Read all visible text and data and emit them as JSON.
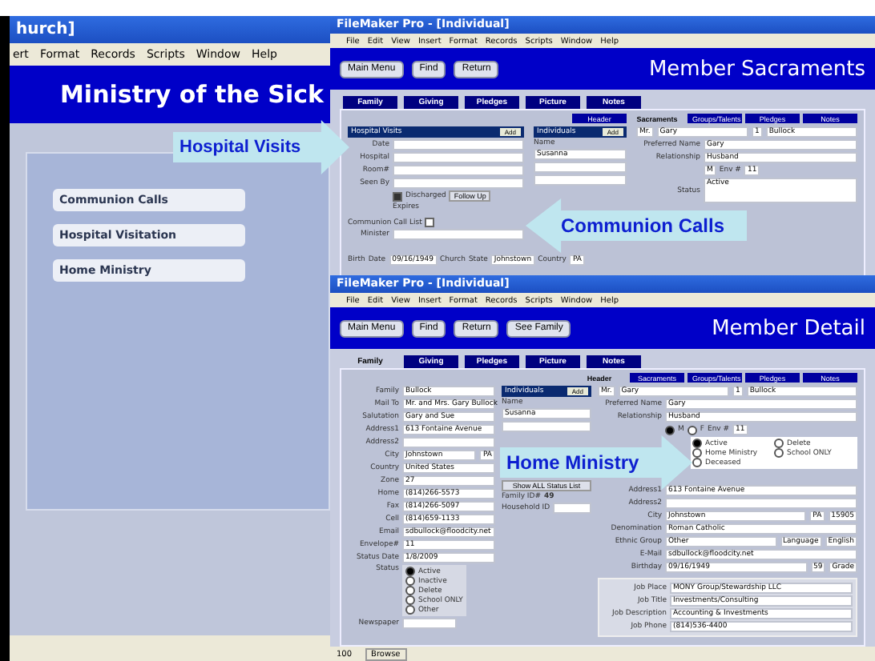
{
  "back_window": {
    "title": "hurch]",
    "menu": [
      "ert",
      "Format",
      "Records",
      "Scripts",
      "Window",
      "Help"
    ],
    "header": "Ministry of the Sick",
    "menu_buttons": [
      "Communion Calls",
      "Hospital Visitation",
      "Home Ministry"
    ]
  },
  "sacraments_window": {
    "title": "FileMaker Pro - [Individual]",
    "menu": [
      "File",
      "Edit",
      "View",
      "Insert",
      "Format",
      "Records",
      "Scripts",
      "Window",
      "Help"
    ],
    "toolbar": [
      "Main Menu",
      "Find",
      "Return"
    ],
    "header": "Member Sacraments",
    "tabs": [
      {
        "label": "Family",
        "selected": false
      },
      {
        "label": "Giving",
        "selected": false
      },
      {
        "label": "Pledges",
        "selected": false
      },
      {
        "label": "Picture",
        "selected": false
      },
      {
        "label": "Notes",
        "selected": false
      }
    ],
    "subtabs": [
      {
        "label": "Header",
        "selected": false
      },
      {
        "label": "Sacraments",
        "selected": true
      },
      {
        "label": "Groups/Talents",
        "selected": false
      },
      {
        "label": "Pledges",
        "selected": false
      },
      {
        "label": "Notes",
        "selected": false
      }
    ],
    "hospital_visits": {
      "title": "Hospital Visits",
      "add": "Add",
      "fields": [
        "Date",
        "Hospital",
        "Room#",
        "Seen By"
      ],
      "discharged": {
        "label": "Discharged",
        "checked": true
      },
      "follow_up": "Follow Up",
      "expires": "Expires"
    },
    "communion": {
      "label": "Communion Call List",
      "checked": false,
      "minister_label": "Minister"
    },
    "birth": {
      "label": "Birth",
      "date_label": "Date",
      "church_label": "Church",
      "date": "09/16/1949",
      "city": "Johnstown",
      "state": "PA"
    },
    "individuals": {
      "title": "Individuals",
      "add": "Add",
      "column": "Name",
      "rows": [
        "Susanna"
      ]
    },
    "member": {
      "title": "Mr.",
      "first": "Gary",
      "number": "1",
      "last": "Bullock",
      "preferred_label": "Preferred Name",
      "preferred": "Gary",
      "relationship_label": "Relationship",
      "relationship": "Husband",
      "sex": "M",
      "env_label": "Env #",
      "env": "11",
      "status_label": "Status",
      "status": "Active",
      "state_label": "State",
      "country_label": "Country"
    }
  },
  "detail_window": {
    "title": "FileMaker Pro - [Individual]",
    "menu": [
      "File",
      "Edit",
      "View",
      "Insert",
      "Format",
      "Records",
      "Scripts",
      "Window",
      "Help"
    ],
    "toolbar": [
      "Main Menu",
      "Find",
      "Return",
      "See Family"
    ],
    "header": "Member Detail",
    "tabs": [
      {
        "label": "Family",
        "selected": true
      },
      {
        "label": "Giving",
        "selected": false
      },
      {
        "label": "Pledges",
        "selected": false
      },
      {
        "label": "Picture",
        "selected": false
      },
      {
        "label": "Notes",
        "selected": false
      }
    ],
    "subtabs": [
      {
        "label": "Header",
        "selected": true
      },
      {
        "label": "Sacraments",
        "selected": false
      },
      {
        "label": "Groups/Talents",
        "selected": false
      },
      {
        "label": "Pledges",
        "selected": false
      },
      {
        "label": "Notes",
        "selected": false
      }
    ],
    "left_fields": [
      {
        "label": "Family",
        "values": [
          "Bullock"
        ]
      },
      {
        "label": "Mail To",
        "values": [
          "Mr. and Mrs. Gary Bullock"
        ]
      },
      {
        "label": "Salutation",
        "values": [
          "Gary and Sue"
        ]
      },
      {
        "label": "Address1",
        "values": [
          "613 Fontaine Avenue"
        ]
      },
      {
        "label": "Address2"
      },
      {
        "label": "City",
        "values": [
          "Johnstown",
          "PA"
        ]
      },
      {
        "label": "Country",
        "values": [
          "United States"
        ]
      },
      {
        "label": "Zone",
        "values": [
          "27"
        ]
      },
      {
        "label": "Home",
        "values": [
          "(814)266-5573"
        ]
      },
      {
        "label": "Fax",
        "values": [
          "(814)266-5097"
        ]
      },
      {
        "label": "Cell",
        "values": [
          "(814)659-1133"
        ]
      },
      {
        "label": "Email",
        "values": [
          "sdbullock@floodcity.net"
        ]
      },
      {
        "label": "Envelope#",
        "values": [
          "11"
        ]
      },
      {
        "label": "Status Date",
        "values": [
          "1/8/2009"
        ]
      }
    ],
    "left_status": {
      "label": "Status",
      "options": [
        {
          "label": "Active",
          "selected": true
        },
        {
          "label": "Inactive",
          "selected": false
        },
        {
          "label": "Delete",
          "selected": false
        },
        {
          "label": "School ONLY",
          "selected": false
        },
        {
          "label": "Other",
          "selected": false
        }
      ]
    },
    "newspaper_label": "Newspaper",
    "individuals": {
      "title": "Individuals",
      "add": "Add",
      "column": "Name",
      "rows": [
        "Susanna"
      ]
    },
    "show_all": "Show ALL Status List",
    "family_id_label": "Family ID#",
    "family_id": "49",
    "household_label": "Household ID",
    "member": {
      "title": "Mr.",
      "first": "Gary",
      "number": "1",
      "last": "Bullock"
    },
    "right_fields": [
      {
        "label": "Preferred Name",
        "values": [
          "Gary"
        ]
      },
      {
        "label": "Relationship",
        "values": [
          "Husband"
        ]
      }
    ],
    "sex_options": [
      {
        "label": "M",
        "selected": true
      },
      {
        "label": "F",
        "selected": false
      }
    ],
    "env_label": "Env #",
    "env": "11",
    "right_status": [
      {
        "label": "Active",
        "selected": true
      },
      {
        "label": "Delete",
        "selected": false
      },
      {
        "label": "Home Ministry",
        "selected": false
      },
      {
        "label": "School ONLY",
        "selected": false
      },
      {
        "label": "Deceased",
        "selected": false
      }
    ],
    "right_fields_2": [
      {
        "label": "Address1",
        "values": [
          "613 Fontaine Avenue"
        ]
      },
      {
        "label": "Address2"
      },
      {
        "label": "City",
        "values": [
          "Johnstown",
          "PA",
          "15905"
        ]
      },
      {
        "label": "Denomination",
        "values": [
          "Roman Catholic"
        ]
      },
      {
        "label": "Ethnic Group",
        "values": [
          "Other",
          "Language",
          "English"
        ]
      },
      {
        "label": "E-Mail",
        "values": [
          "sdbullock@floodcity.net"
        ]
      },
      {
        "label": "Birthday",
        "values": [
          "09/16/1949",
          "59",
          "Grade"
        ]
      }
    ],
    "job_fields": [
      {
        "label": "Job Place",
        "values": [
          "MONY Group/Stewardship LLC"
        ]
      },
      {
        "label": "Job Title",
        "values": [
          "Investments/Consulting"
        ]
      },
      {
        "label": "Job Description",
        "values": [
          "Accounting & Investments"
        ]
      },
      {
        "label": "Job Phone",
        "values": [
          "(814)536-4400"
        ]
      }
    ],
    "status_bar": {
      "zoom": "100",
      "mode": "Browse"
    }
  },
  "callouts": [
    {
      "text": "Hospital Visits"
    },
    {
      "text": "Communion Calls"
    },
    {
      "text": "Home Ministry"
    }
  ]
}
